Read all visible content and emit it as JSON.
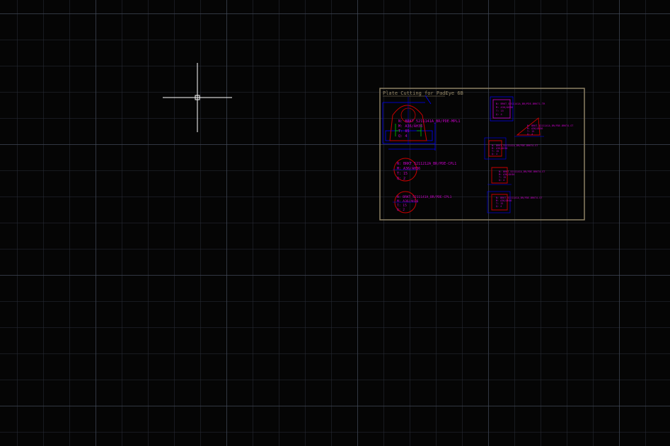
{
  "drawing": {
    "title": "Plate Cutting for PadEye 6B",
    "colors": {
      "background": "#050505",
      "frame": "#8c8064",
      "geometry": "#0000ff",
      "annotation": "#cc00cc",
      "profile": "#cc0000",
      "centerline": "#00cc00",
      "cursor": "#ffffff"
    },
    "parts": [
      {
        "lines": [
          "N: BRKT_5211141A_BR/PDE-MPL1",
          "M: A36/AH36",
          "T: 85",
          "Q: 4"
        ]
      },
      {
        "lines": [
          "N: BRKT_5211212A_BR/PDE-CPL1",
          "M: A36/AH36",
          "T: 15",
          "Q: 2"
        ]
      },
      {
        "lines": [
          "N: BRKT_5211141A_BR/PDE-CPL1",
          "M: A36/AH36",
          "T: 15",
          "Q: 2"
        ]
      },
      {
        "lines": [
          "N: BRKT_5211141A_BR/PDE-BRKT1-TR",
          "M: A36/AH36",
          "T: 15",
          "Q: 4"
        ]
      },
      {
        "lines": [
          "N: BRKT_5211141A_BR/PDE-BRKT4-ST",
          "M: A36/AH36",
          "T: 15",
          "Q: 4"
        ]
      },
      {
        "lines": [
          "N: BRKT_5211141A_BR/PDE-BRKT4-ST",
          "M: A36/AH36",
          "T: 15",
          "Q: 4"
        ]
      },
      {
        "lines": [
          "N: BRKT_5211141A_BR/PDE-BRKT4-ST",
          "M: A36/AH36",
          "T: 15",
          "Q: 4"
        ]
      },
      {
        "lines": [
          "N: BRKT_5211141A_BR/PDE-BRKT4-ST",
          "M: A36/AH36",
          "T: 15",
          "Q: 4"
        ]
      }
    ]
  }
}
